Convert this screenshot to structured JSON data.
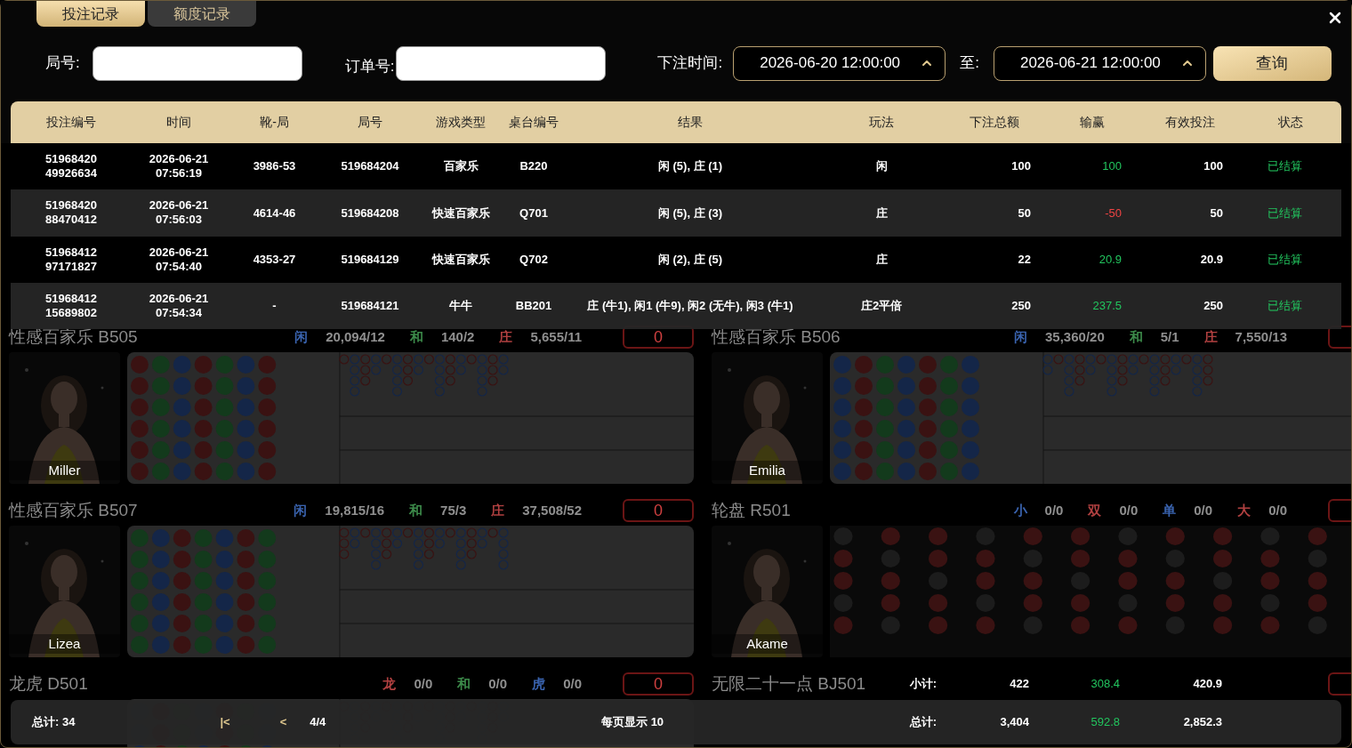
{
  "lobby": [
    {
      "title": "性感百家乐 B505",
      "stats": [
        {
          "label": "闲",
          "value": "20,094/12",
          "color": "#3a64b0"
        },
        {
          "label": "和",
          "value": "140/2",
          "color": "#3c8a4a"
        },
        {
          "label": "庄",
          "value": "5,655/11",
          "color": "#b04040"
        }
      ],
      "badge": "0",
      "dealer": "Miller",
      "kind": "baccarat"
    },
    {
      "title": "性感百家乐 B506",
      "stats": [
        {
          "label": "闲",
          "value": "35,360/20",
          "color": "#3a64b0"
        },
        {
          "label": "和",
          "value": "5/1",
          "color": "#3c8a4a"
        },
        {
          "label": "庄",
          "value": "7,550/13",
          "color": "#b04040"
        }
      ],
      "dealer": "Emilia",
      "kind": "baccarat"
    },
    {
      "title": "性感百家乐 B507",
      "stats": [
        {
          "label": "闲",
          "value": "19,815/16",
          "color": "#3a64b0"
        },
        {
          "label": "和",
          "value": "75/3",
          "color": "#3c8a4a"
        },
        {
          "label": "庄",
          "value": "37,508/52",
          "color": "#b04040"
        }
      ],
      "badge": "0",
      "dealer": "Lizea",
      "kind": "baccarat"
    },
    {
      "title": "轮盘 R501",
      "stats": [
        {
          "label": "小",
          "value": "0/0",
          "color": "#3a64b0"
        },
        {
          "label": "双",
          "value": "0/0",
          "color": "#b04040"
        },
        {
          "label": "单",
          "value": "0/0",
          "color": "#3a64b0"
        },
        {
          "label": "大",
          "value": "0/0",
          "color": "#b04040"
        }
      ],
      "dealer": "Akame",
      "kind": "roulette"
    },
    {
      "title": "龙虎 D501",
      "stats": [
        {
          "label": "龙",
          "value": "0/0",
          "color": "#b04040"
        },
        {
          "label": "和",
          "value": "0/0",
          "color": "#3c8a4a"
        },
        {
          "label": "虎",
          "value": "0/0",
          "color": "#3a64b0"
        }
      ],
      "badge": "0",
      "kind": "baccarat"
    },
    {
      "title": "无限二十一点 BJ501",
      "kind": "blackjack"
    }
  ],
  "tabs": [
    {
      "label": "投注记录",
      "selected": true
    },
    {
      "label": "额度记录",
      "selected": false
    }
  ],
  "filters": {
    "round_label": "局号:",
    "order_label": "订单号:",
    "time_label": "下注时间:",
    "start": "2026-06-20 12:00:00",
    "to_label": "至:",
    "end": "2026-06-21 12:00:00",
    "query": "查询"
  },
  "table": {
    "columns": [
      "投注编号",
      "时间",
      "靴-局",
      "局号",
      "游戏类型",
      "桌台编号",
      "结果",
      "玩法",
      "下注总额",
      "输赢",
      "有效投注",
      "状态"
    ],
    "rows": [
      {
        "id": [
          "51968420",
          "49926634"
        ],
        "time": [
          "2026-06-21",
          "07:56:19"
        ],
        "shoe": "3986-53",
        "round": "519684204",
        "game": "百家乐",
        "table": "B220",
        "result": "闲 (5), 庄 (1)",
        "play": "闲",
        "amount": "100",
        "winloss": "100",
        "color": "#22c55e",
        "valid": "100",
        "status": "已结算"
      },
      {
        "id": [
          "51968420",
          "88470412"
        ],
        "time": [
          "2026-06-21",
          "07:56:03"
        ],
        "shoe": "4614-46",
        "round": "519684208",
        "game": "快速百家乐",
        "table": "Q701",
        "result": "闲 (5), 庄 (3)",
        "play": "庄",
        "amount": "50",
        "winloss": "-50",
        "color": "#ef4444",
        "valid": "50",
        "status": "已结算"
      },
      {
        "id": [
          "51968412",
          "97171827"
        ],
        "time": [
          "2026-06-21",
          "07:54:40"
        ],
        "shoe": "4353-27",
        "round": "519684129",
        "game": "快速百家乐",
        "table": "Q702",
        "result": "闲 (2), 庄 (5)",
        "play": "庄",
        "amount": "22",
        "winloss": "20.9",
        "color": "#22c55e",
        "valid": "20.9",
        "status": "已结算"
      },
      {
        "id": [
          "51968412",
          "15689802"
        ],
        "time": [
          "2026-06-21",
          "07:54:34"
        ],
        "shoe": "-",
        "round": "519684121",
        "game": "牛牛",
        "table": "BB201",
        "result": "庄 (牛1), 闲1 (牛9), 闲2 (无牛), 闲3 (牛1)",
        "play": "庄2平倍",
        "amount": "250",
        "winloss": "237.5",
        "color": "#22c55e",
        "valid": "250",
        "status": "已结算"
      }
    ]
  },
  "subtotal": {
    "label": "小计:",
    "amount": "422",
    "winloss": "308.4",
    "valid": "420.9"
  },
  "footer": {
    "count_label": "总计:",
    "count": "34",
    "first": "|<",
    "prev": "<",
    "page": "4/4",
    "per_page_label": "每页显示",
    "per_page": "10",
    "total_label": "总计:",
    "amount": "3,404",
    "winloss": "592.8",
    "valid": "2,852.3"
  }
}
